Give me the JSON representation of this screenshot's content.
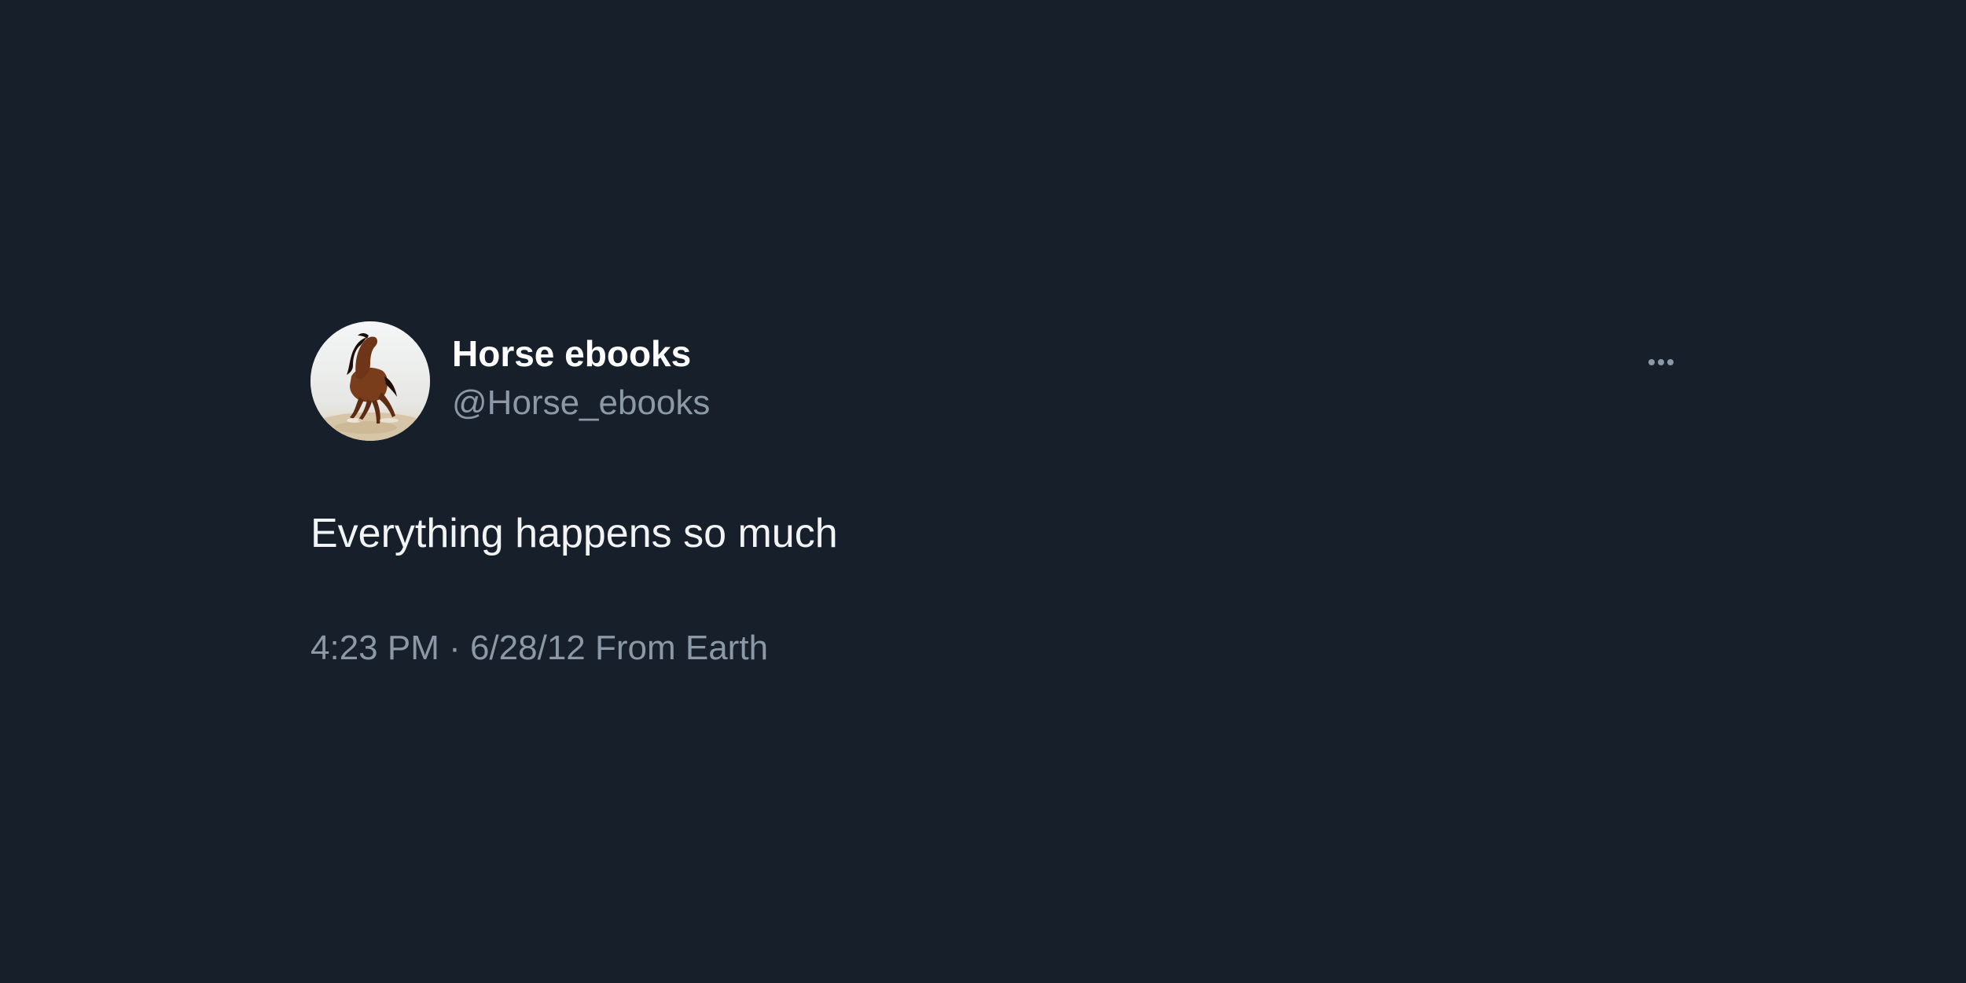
{
  "colors": {
    "background": "#17202a",
    "name_text": "#ffffff",
    "body_text": "#f1f3f5",
    "secondary_text": "#8b98a5"
  },
  "tweet": {
    "avatar_icon": "horse-avatar-icon",
    "display_name": "Horse ebooks",
    "handle": "@Horse_ebooks",
    "more_icon": "more-options-icon",
    "text": "Everything happens so much",
    "meta": "4:23 PM · 6/28/12 From Earth"
  }
}
